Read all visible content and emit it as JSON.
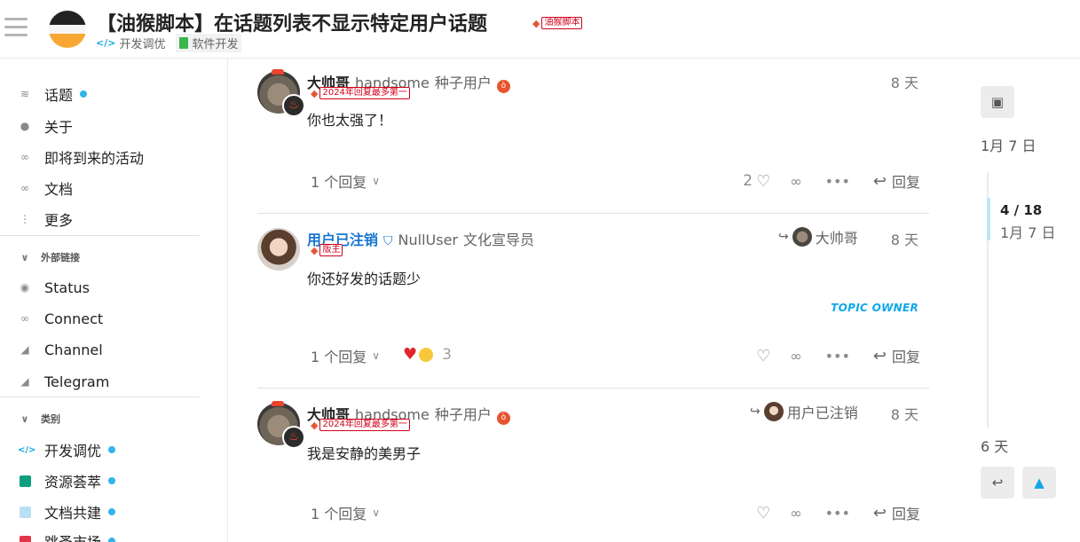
{
  "header": {
    "title": "【油猴脚本】在话题列表不显示特定用户话题",
    "title_tag": "油猴脚本",
    "categories": [
      "开发调优",
      "软件开发"
    ]
  },
  "sidebar": {
    "top_items": [
      "话题",
      "关于",
      "即将到来的活动",
      "文档",
      "更多"
    ],
    "section_links": "外部链接",
    "links": [
      "Status",
      "Connect",
      "Channel",
      "Telegram"
    ],
    "section_categories": "类别",
    "categories": [
      {
        "name": "开发调优",
        "color": "#12a7e8"
      },
      {
        "name": "资源荟萃",
        "color": "#0e9f7e"
      },
      {
        "name": "文档共建",
        "color": "#b9dff5"
      },
      {
        "name": "跳蚤市场",
        "color": "#e2364b"
      }
    ]
  },
  "posts": [
    {
      "username": "大帅哥",
      "full_name": "handsome",
      "title": "种子用户",
      "badge": "2024年回复最多第一",
      "date": "8 天",
      "content": "你也太强了！",
      "replies": "1 个回复",
      "likes": "2",
      "reply_label": "回复"
    },
    {
      "username": "用户已注销",
      "full_name": "NullUser",
      "title": "文化宣导员",
      "badge": "版主",
      "reply_to": "大帅哥",
      "date": "8 天",
      "content": "你还好发的话题少",
      "owner_label": "TOPIC OWNER",
      "replies": "1 个回复",
      "reaction_count": "3",
      "reply_label": "回复"
    },
    {
      "username": "大帅哥",
      "full_name": "handsome",
      "title": "种子用户",
      "badge": "2024年回复最多第一",
      "reply_to": "用户已注销",
      "date": "8 天",
      "content": "我是安静的美男子",
      "replies": "1 个回复",
      "reply_label": "回复"
    }
  ],
  "timeline": {
    "start_date": "1月 7 日",
    "position": "4 / 18",
    "position_date": "1月 7 日",
    "end_date": "6 天"
  }
}
